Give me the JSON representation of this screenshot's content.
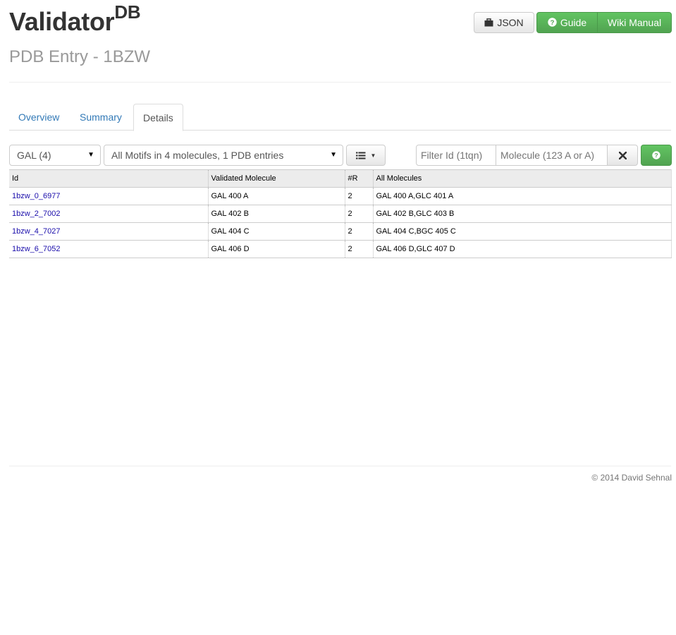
{
  "header": {
    "title": "Validator",
    "title_sup": "DB",
    "subtitle": "PDB Entry - 1BZW"
  },
  "toolbar": {
    "json_label": "JSON",
    "guide_label": "Guide",
    "wiki_label": "Wiki Manual"
  },
  "tabs": [
    {
      "label": "Overview",
      "active": false
    },
    {
      "label": "Summary",
      "active": false
    },
    {
      "label": "Details",
      "active": true
    }
  ],
  "filters": {
    "residue_select": "GAL (4)",
    "motif_select": "All Motifs in 4 molecules, 1 PDB entries",
    "filter_id_placeholder": "Filter Id (1tqn)",
    "molecule_placeholder": "Molecule (123 A or A)"
  },
  "table": {
    "columns": [
      "Id",
      "Validated Molecule",
      "#R",
      "All Molecules"
    ],
    "rows": [
      {
        "id": "1bzw_0_6977",
        "validated": "GAL 400 A",
        "r": "2",
        "all": "GAL 400 A,GLC 401 A"
      },
      {
        "id": "1bzw_2_7002",
        "validated": "GAL 402 B",
        "r": "2",
        "all": "GAL 402 B,GLC 403 B"
      },
      {
        "id": "1bzw_4_7027",
        "validated": "GAL 404 C",
        "r": "2",
        "all": "GAL 404 C,BGC 405 C"
      },
      {
        "id": "1bzw_6_7052",
        "validated": "GAL 406 D",
        "r": "2",
        "all": "GAL 406 D,GLC 407 D"
      }
    ]
  },
  "footer": {
    "copyright": "© 2014 David Sehnal"
  },
  "icons": {
    "json": "briefcase-icon",
    "guide": "question-circle-icon",
    "list": "list-icon",
    "clear": "remove-icon",
    "help": "question-circle-icon"
  },
  "colors": {
    "accent_green": "#5cb85c",
    "link_blue": "#337ab7",
    "table_link": "#1a0dab"
  }
}
